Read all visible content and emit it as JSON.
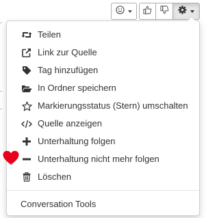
{
  "toolbar": {
    "emoji_icon": "smiley-icon",
    "like_icon": "thumbs-up-icon",
    "dislike_icon": "thumbs-down-icon",
    "settings_icon": "gear-icon"
  },
  "menu": {
    "items": [
      {
        "label": "Teilen",
        "icon": "retweet-icon"
      },
      {
        "label": "Link zur Quelle",
        "icon": "external-link-icon"
      },
      {
        "label": "Tag hinzufügen",
        "icon": "tag-icon"
      },
      {
        "label": "In Ordner speichern",
        "icon": "folder-open-icon"
      },
      {
        "label": "Markierungsstatus (Stern) umschalten",
        "icon": "star-icon"
      },
      {
        "label": "Quelle anzeigen",
        "icon": "code-icon"
      },
      {
        "label": "Unterhaltung folgen",
        "icon": "plus-icon"
      },
      {
        "label": "Unterhaltung nicht mehr folgen",
        "icon": "minus-icon"
      },
      {
        "label": "Löschen",
        "icon": "trash-icon"
      }
    ],
    "tools_label": "Conversation Tools"
  },
  "annotation": {
    "marker_icon": "heart-icon",
    "marker_color": "#e8001c"
  },
  "colors": {
    "text": "#333333",
    "border": "#adadad",
    "active_button": "#e6e6e6"
  }
}
